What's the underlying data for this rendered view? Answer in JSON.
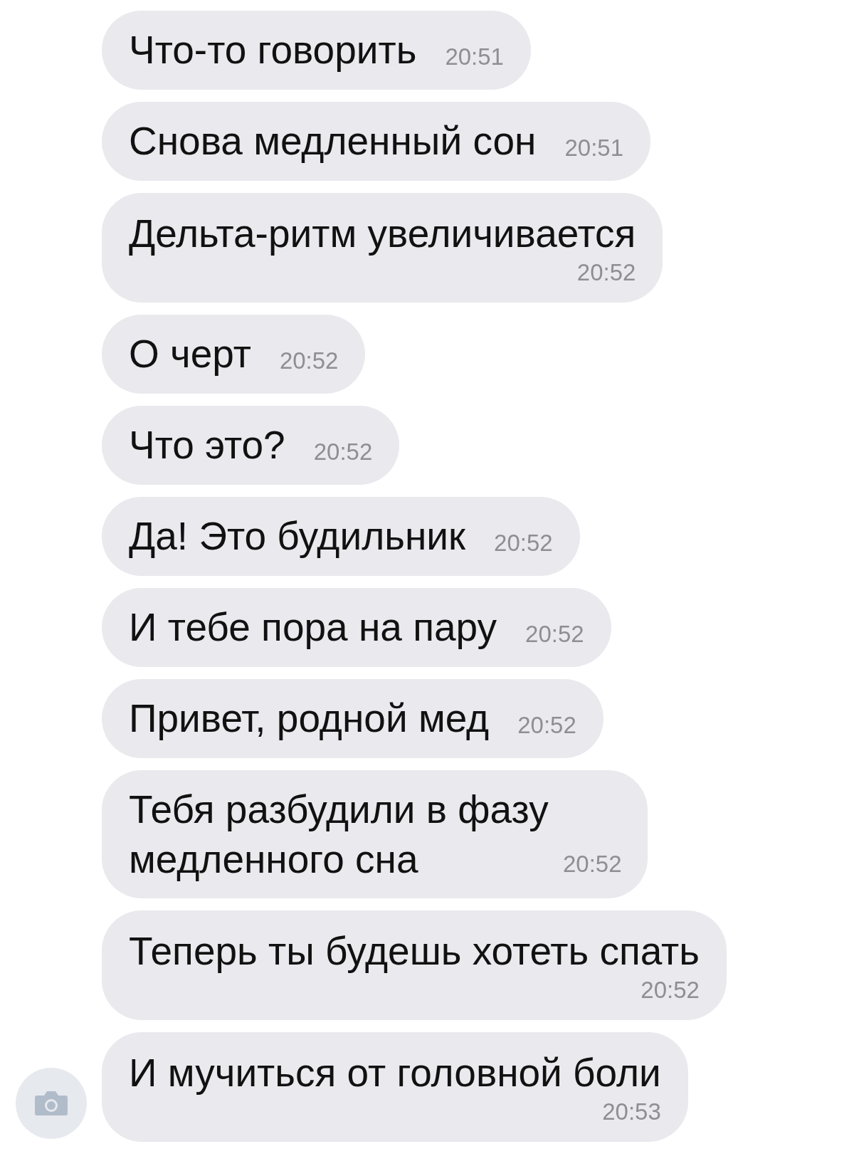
{
  "messages": [
    {
      "kind": "inline",
      "text": "Что-то говорить",
      "time": "20:51"
    },
    {
      "kind": "inline",
      "text": "Снова медленный сон",
      "time": "20:51"
    },
    {
      "kind": "stacked",
      "text": "Дельта-ритм увеличивается",
      "time": "20:52"
    },
    {
      "kind": "inline",
      "text": "О черт",
      "time": "20:52"
    },
    {
      "kind": "inline",
      "text": "Что это?",
      "time": "20:52"
    },
    {
      "kind": "inline",
      "text": "Да! Это будильник",
      "time": "20:52"
    },
    {
      "kind": "inline",
      "text": "И тебе пора на пару",
      "time": "20:52"
    },
    {
      "kind": "inline",
      "text": "Привет, родной мед",
      "time": "20:52"
    },
    {
      "kind": "wrapped",
      "text": "Тебя разбудили в фазу медленного сна",
      "time": "20:52"
    },
    {
      "kind": "stacked",
      "text": "Теперь ты будешь хотеть спать",
      "time": "20:52"
    },
    {
      "kind": "stacked",
      "text": "И мучиться от головной боли",
      "time": "20:53"
    }
  ]
}
